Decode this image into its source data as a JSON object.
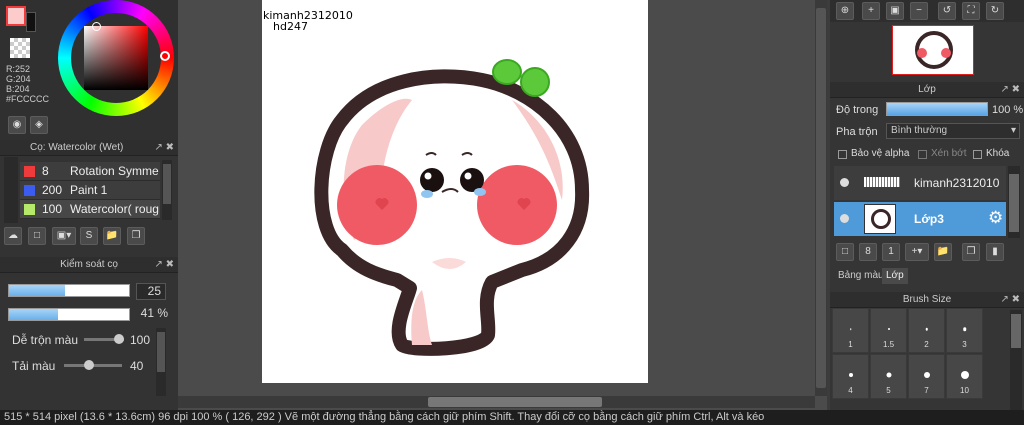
{
  "color": {
    "r_label": "R:252",
    "g_label": "G:204",
    "b_label": "B:204",
    "hex_label": "#FCCCCC",
    "foreground": "#fccccc",
    "background": "#ffffff"
  },
  "brush_panel": {
    "title": "Cọ: Watercolor (Wet)",
    "items": [
      {
        "color": "#ef3b3b",
        "size": "8",
        "name": "Rotation Symme"
      },
      {
        "color": "#3b5cef",
        "size": "200",
        "name": "Paint 1"
      },
      {
        "color": "#b6e86a",
        "size": "100",
        "name": "Watercolor( roug"
      }
    ]
  },
  "brush_control": {
    "title": "Kiểm soát cọ",
    "size_value": "25",
    "size_fraction": 0.47,
    "opacity_value": "41 %",
    "opacity_fraction": 0.41,
    "blend_label": "Dễ trộn màu",
    "blend_value": "100",
    "reload_label": "Tải màu",
    "reload_value": "40"
  },
  "canvas": {
    "signature_line1": "kimanh2312010",
    "signature_line2": "hd247"
  },
  "layers_panel": {
    "title": "Lớp",
    "opacity_label": "Độ trong",
    "opacity_value": "100 %",
    "blend_label": "Pha trộn",
    "blend_mode": "Bình thường",
    "protect_alpha": "Bảo vệ alpha",
    "clipping": "Xén bớt",
    "lock": "Khóa",
    "layers": [
      {
        "name": "kimanh2312010",
        "selected": false
      },
      {
        "name": "Lớp3",
        "selected": true
      }
    ],
    "tabs": [
      "Bảng màu",
      "Lớp"
    ],
    "active_tab": "Lớp"
  },
  "brush_size_panel": {
    "title": "Brush Size",
    "sizes": [
      "1",
      "1.5",
      "2",
      "3",
      "4",
      "5",
      "7",
      "10"
    ]
  },
  "status": {
    "text": "515 * 514 pixel   (13.6 * 13.6cm)   96 dpi   100 %   ( 126, 292 )   Vẽ một đường thẳng bằng cách giữ phím Shift. Thay đổi cỡ cọ bằng cách giữ phím Ctrl, Alt và kéo"
  },
  "accent": "#4f9bd9"
}
